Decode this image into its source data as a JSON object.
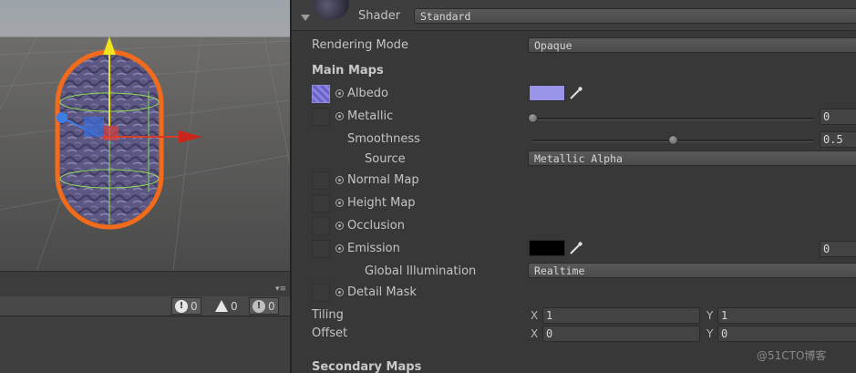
{
  "scene": {
    "capsule_color": "#5e5a86",
    "selection_color": "#f26b1d"
  },
  "console": {
    "menu_icon": "▾≡",
    "errors": {
      "icon": "!",
      "count": "0"
    },
    "warnings": {
      "icon": "warning-icon",
      "count": "0"
    },
    "messages": {
      "icon": "!",
      "count": "0"
    }
  },
  "inspector": {
    "shader": {
      "label": "Shader",
      "value": "Standard"
    },
    "rendering_mode": {
      "label": "Rendering Mode",
      "value": "Opaque"
    },
    "main_maps": {
      "title": "Main Maps",
      "albedo": {
        "label": "Albedo",
        "color": "#9a94e8"
      },
      "metallic": {
        "label": "Metallic",
        "value": "0",
        "fraction": 0
      },
      "smoothness": {
        "label": "Smoothness",
        "value": "0.5",
        "fraction": 0.5
      },
      "source": {
        "label": "Source",
        "value": "Metallic Alpha"
      },
      "normal_map": {
        "label": "Normal Map"
      },
      "height_map": {
        "label": "Height Map"
      },
      "occlusion": {
        "label": "Occlusion"
      },
      "emission": {
        "label": "Emission",
        "value": "0",
        "color": "#000000"
      },
      "global_illumination": {
        "label": "Global Illumination",
        "value": "Realtime"
      },
      "detail_mask": {
        "label": "Detail Mask"
      },
      "tiling": {
        "label": "Tiling",
        "x_label": "X",
        "x": "1",
        "y_label": "Y",
        "y": "1"
      },
      "offset": {
        "label": "Offset",
        "x_label": "X",
        "x": "0",
        "y_label": "Y",
        "y": "0"
      }
    },
    "secondary_maps": {
      "title": "Secondary Maps"
    }
  },
  "watermark": "@51CTO博客"
}
